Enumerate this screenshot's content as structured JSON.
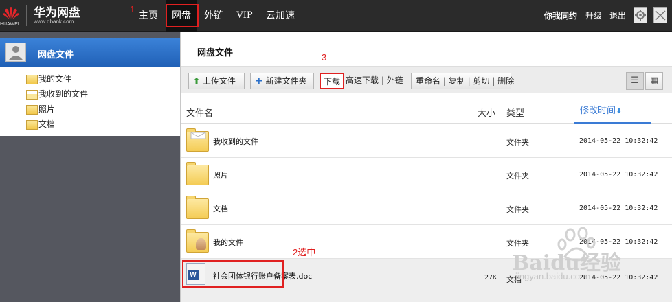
{
  "brand": {
    "company": "HUAWEI",
    "title": "华为网盘",
    "url": "www.dbank.com"
  },
  "nav": {
    "home": "主页",
    "disk": "网盘",
    "share": "外链",
    "vip": "VIP",
    "accel": "云加速"
  },
  "user": {
    "name": "你我同约",
    "upgrade": "升级",
    "logout": "退出"
  },
  "annotations": {
    "a1": "1",
    "a2": "2选中",
    "a3": "3"
  },
  "sidebar": {
    "title": "网盘文件",
    "items": [
      {
        "label": "我的文件",
        "icon": "user-folder-icon"
      },
      {
        "label": "我收到的文件",
        "icon": "inbox-folder-icon"
      },
      {
        "label": "照片",
        "icon": "folder-icon"
      },
      {
        "label": "文档",
        "icon": "folder-icon"
      }
    ]
  },
  "main": {
    "title": "网盘文件",
    "toolbar": {
      "upload": "上传文件",
      "new_folder": "新建文件夹",
      "download": "下载",
      "fast_download": "高速下载",
      "share_link": "外链",
      "rename": "重命名",
      "copy": "复制",
      "cut": "剪切",
      "delete": "删除",
      "separator": "|"
    },
    "columns": {
      "name": "文件名",
      "size": "大小",
      "type": "类型",
      "mtime": "修改时间"
    },
    "rows": [
      {
        "name": "我收到的文件",
        "size": "",
        "type": "文件夹",
        "mtime": "2014-05-22 10:32:42",
        "icon": "inbox-folder-icon"
      },
      {
        "name": "照片",
        "size": "",
        "type": "文件夹",
        "mtime": "2014-05-22 10:32:42",
        "icon": "folder-icon"
      },
      {
        "name": "文档",
        "size": "",
        "type": "文件夹",
        "mtime": "2014-05-22 10:32:42",
        "icon": "folder-icon"
      },
      {
        "name": "我的文件",
        "size": "",
        "type": "文件夹",
        "mtime": "2014-05-22 10:32:42",
        "icon": "user-folder-icon"
      },
      {
        "name": "社会团体银行账户备案表.doc",
        "size": "27K",
        "type": "文档",
        "mtime": "2014-05-22 10:32:42",
        "icon": "word-doc-icon"
      }
    ]
  },
  "watermark": {
    "text": "Baidu经验",
    "url": "jingyan.baidu.com"
  },
  "colors": {
    "topbar": "#2b2b2b",
    "sidebar_head": "#1f5fb5",
    "sidebar": "#55575f",
    "highlight": "#e02020",
    "sort_accent": "#3a7bd5"
  }
}
